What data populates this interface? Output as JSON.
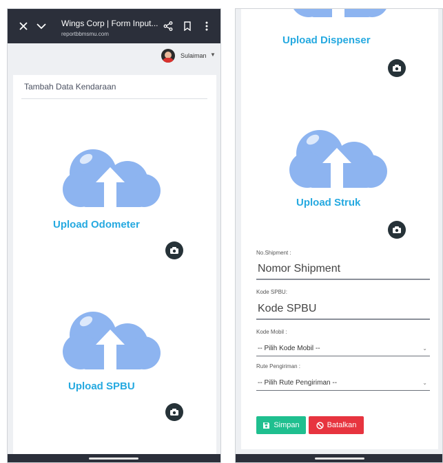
{
  "browser": {
    "title": "Wings Corp | Form Input...",
    "url": "reportbbmsmu.com",
    "icons": [
      "close-icon",
      "chevron-down-icon",
      "share-icon",
      "bookmark-icon",
      "more-vert-icon"
    ]
  },
  "user": {
    "name": "Sulaiman"
  },
  "form": {
    "title": "Tambah Data Kendaraan",
    "uploads": {
      "odometer": "Upload Odometer",
      "spbu": "Upload SPBU",
      "dispenser": "Upload Dispenser",
      "struk": "Upload Struk"
    },
    "fields": {
      "shipment": {
        "label": "No.Shipment :",
        "placeholder": "Nomor Shipment"
      },
      "kode_spbu": {
        "label": "Kode SPBU:",
        "placeholder": "Kode SPBU"
      },
      "kode_mobil": {
        "label": "Kode Mobil :",
        "selected": "-- Pilih Kode Mobil --"
      },
      "rute": {
        "label": "Rute Pengiriman :",
        "selected": "-- Pilih Rute Pengiriman --"
      }
    },
    "buttons": {
      "save": "Simpan",
      "cancel": "Batalkan"
    }
  },
  "colors": {
    "accent_text": "#25a9e0",
    "cloud": "#8db4f0",
    "save": "#1fbf8f",
    "cancel": "#e7343f",
    "browser_bar": "#2b2f3a"
  }
}
